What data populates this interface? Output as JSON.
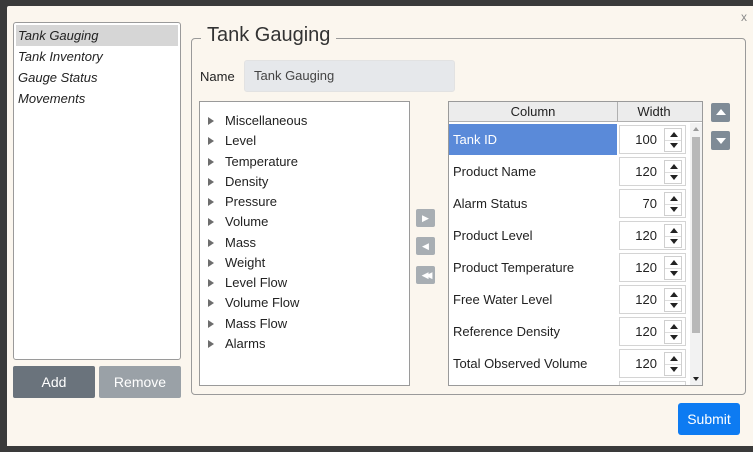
{
  "window": {
    "close_glyph": "x"
  },
  "left_list": {
    "items": [
      {
        "label": "Tank Gauging",
        "selected": true
      },
      {
        "label": "Tank Inventory"
      },
      {
        "label": "Gauge Status"
      },
      {
        "label": "Movements"
      }
    ],
    "add_label": "Add",
    "remove_label": "Remove"
  },
  "group": {
    "title": "Tank Gauging",
    "name_label": "Name",
    "name_value": "Tank Gauging"
  },
  "tree": {
    "items": [
      "Miscellaneous",
      "Level",
      "Temperature",
      "Density",
      "Pressure",
      "Volume",
      "Mass",
      "Weight",
      "Level Flow",
      "Volume Flow",
      "Mass Flow",
      "Alarms"
    ]
  },
  "grid": {
    "headers": {
      "column": "Column",
      "width": "Width"
    },
    "rows": [
      {
        "name": "Tank ID",
        "width": "100",
        "selected": true
      },
      {
        "name": "Product Name",
        "width": "120"
      },
      {
        "name": "Alarm Status",
        "width": "70"
      },
      {
        "name": "Product Level",
        "width": "120"
      },
      {
        "name": "Product Temperature",
        "width": "120"
      },
      {
        "name": "Free Water Level",
        "width": "120"
      },
      {
        "name": "Reference Density",
        "width": "120"
      },
      {
        "name": "Total Observed Volume",
        "width": "120"
      }
    ]
  },
  "actions": {
    "submit_label": "Submit"
  },
  "colors": {
    "selected_row": "#5a8ad9",
    "submit": "#0d7bf2",
    "add_button": "#6a737c",
    "remove_button": "#9aa1a7"
  }
}
